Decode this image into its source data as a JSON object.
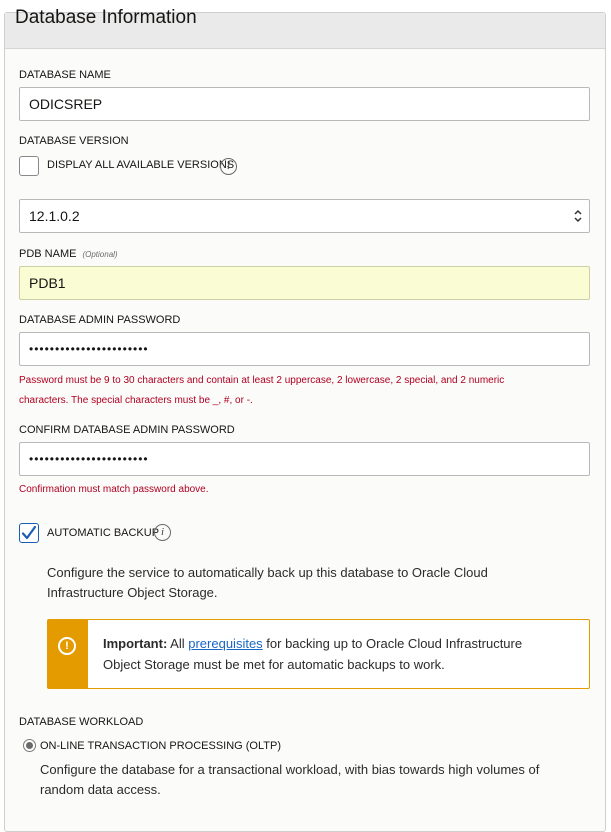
{
  "section": {
    "title": "Database Information"
  },
  "database_name": {
    "label": "DATABASE NAME",
    "value": "ODICSREP"
  },
  "database_version": {
    "label": "DATABASE VERSION",
    "display_all_label": "DISPLAY ALL AVAILABLE VERSIONS",
    "display_all_checked": false,
    "selected": "12.1.0.2"
  },
  "pdb_name": {
    "label": "PDB NAME",
    "optional": "(Optional)",
    "value": "PDB1"
  },
  "admin_password": {
    "label": "DATABASE ADMIN PASSWORD",
    "value": "•••••••••••••••••••••••",
    "error_line1": "Password must be 9 to 30 characters and contain at least 2 uppercase, 2 lowercase, 2 special, and 2 numeric",
    "error_line2": "characters. The special characters must be _, #, or -."
  },
  "confirm_password": {
    "label": "CONFIRM DATABASE ADMIN PASSWORD",
    "value": "•••••••••••••••••••••••",
    "error": "Confirmation must match password above."
  },
  "automatic_backup": {
    "label": "AUTOMATIC BACKUP",
    "checked": true,
    "description_line1": "Configure the service to automatically back up this database to Oracle Cloud",
    "description_line2": "Infrastructure Object Storage."
  },
  "callout": {
    "bold": "Important:",
    "pre_link": " All ",
    "link": "prerequisites",
    "post_link": " for backing up to Oracle Cloud Infrastructure",
    "line2": "Object Storage must be met for automatic backups to work."
  },
  "workload": {
    "label": "DATABASE WORKLOAD",
    "option_oltp": "ON-LINE TRANSACTION PROCESSING (OLTP)",
    "description_line1": "Configure the database for a transactional workload, with bias towards high volumes of",
    "description_line2": "random data access."
  },
  "colors": {
    "accent": "#1a5fb4",
    "warning": "#e39b00",
    "error": "#b00020",
    "highlight": "#fafcd3"
  },
  "icons": [
    "info-icon",
    "checkmark-icon",
    "select-arrows-icon",
    "warning-icon",
    "radio-icon"
  ]
}
